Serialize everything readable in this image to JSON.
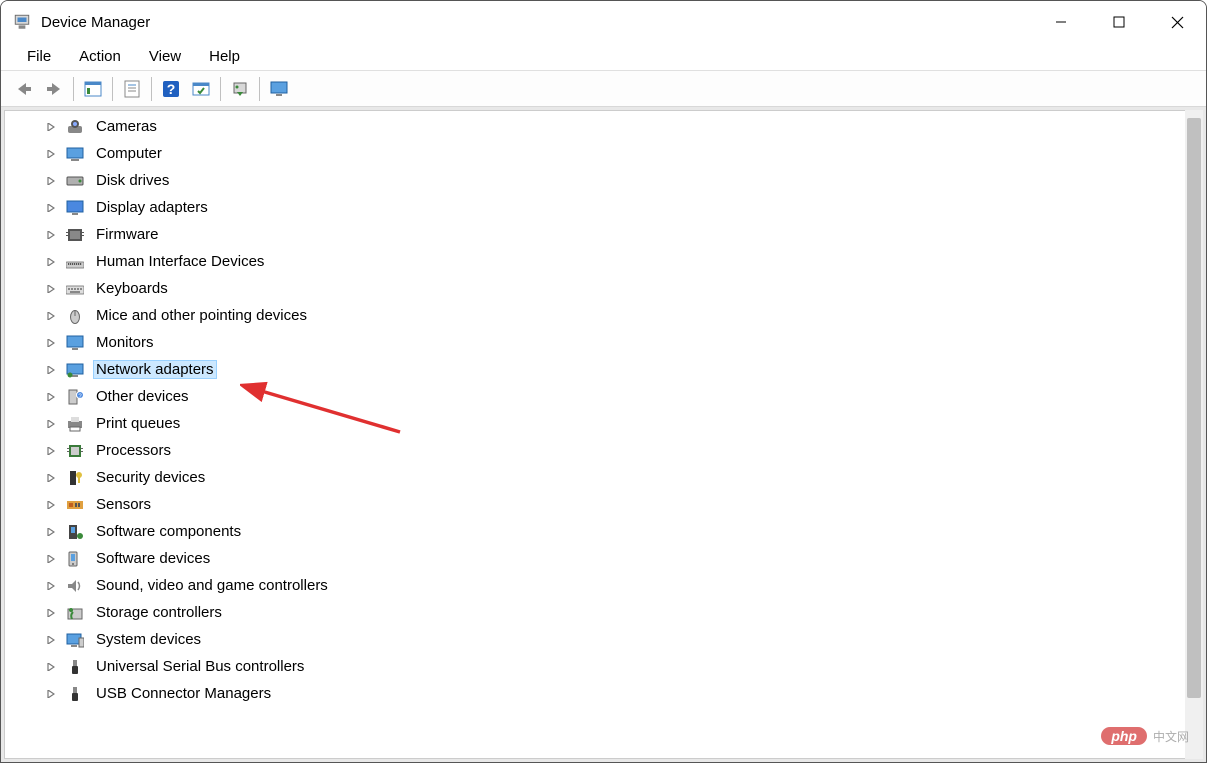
{
  "window": {
    "title": "Device Manager"
  },
  "menu": {
    "items": [
      "File",
      "Action",
      "View",
      "Help"
    ]
  },
  "toolbar": {
    "buttons": [
      "back",
      "forward",
      "show-hidden",
      "properties",
      "help",
      "scan",
      "update-driver",
      "monitor"
    ]
  },
  "tree": {
    "items": [
      {
        "label": "Cameras",
        "icon": "camera",
        "selected": false
      },
      {
        "label": "Computer",
        "icon": "computer",
        "selected": false
      },
      {
        "label": "Disk drives",
        "icon": "disk",
        "selected": false
      },
      {
        "label": "Display adapters",
        "icon": "display",
        "selected": false
      },
      {
        "label": "Firmware",
        "icon": "firmware",
        "selected": false
      },
      {
        "label": "Human Interface Devices",
        "icon": "hid",
        "selected": false
      },
      {
        "label": "Keyboards",
        "icon": "keyboard",
        "selected": false
      },
      {
        "label": "Mice and other pointing devices",
        "icon": "mouse",
        "selected": false
      },
      {
        "label": "Monitors",
        "icon": "monitor",
        "selected": false
      },
      {
        "label": "Network adapters",
        "icon": "network",
        "selected": true
      },
      {
        "label": "Other devices",
        "icon": "other",
        "selected": false
      },
      {
        "label": "Print queues",
        "icon": "printer",
        "selected": false
      },
      {
        "label": "Processors",
        "icon": "processor",
        "selected": false
      },
      {
        "label": "Security devices",
        "icon": "security",
        "selected": false
      },
      {
        "label": "Sensors",
        "icon": "sensor",
        "selected": false
      },
      {
        "label": "Software components",
        "icon": "software-component",
        "selected": false
      },
      {
        "label": "Software devices",
        "icon": "software-device",
        "selected": false
      },
      {
        "label": "Sound, video and game controllers",
        "icon": "sound",
        "selected": false
      },
      {
        "label": "Storage controllers",
        "icon": "storage",
        "selected": false
      },
      {
        "label": "System devices",
        "icon": "system",
        "selected": false
      },
      {
        "label": "Universal Serial Bus controllers",
        "icon": "usb",
        "selected": false
      },
      {
        "label": "USB Connector Managers",
        "icon": "usb-connector",
        "selected": false
      }
    ]
  },
  "watermark": {
    "badge": "php",
    "text": "中文网"
  }
}
